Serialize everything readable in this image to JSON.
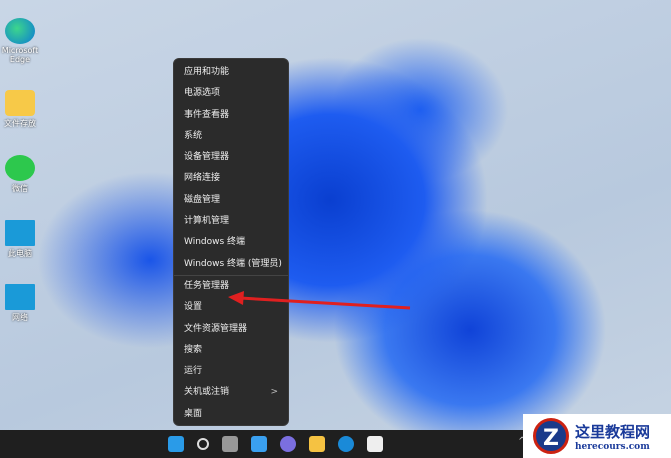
{
  "desktop_icons": [
    {
      "label": "Microsoft Edge",
      "icon": "edge-icon"
    },
    {
      "label": "文件存放",
      "icon": "folder-icon"
    },
    {
      "label": "微信",
      "icon": "wechat-icon"
    },
    {
      "label": "此电脑",
      "icon": "computer-icon"
    },
    {
      "label": "网络",
      "icon": "network-icon"
    }
  ],
  "menu": {
    "items": [
      "应用和功能",
      "电源选项",
      "事件查看器",
      "系统",
      "设备管理器",
      "网络连接",
      "磁盘管理",
      "计算机管理",
      "Windows 终端",
      "Windows 终端 (管理员)",
      "任务管理器",
      "设置",
      "文件资源管理器",
      "搜索",
      "运行",
      "关机或注销",
      "桌面"
    ],
    "chevron": ">"
  },
  "taskbar": {
    "items": [
      "start-icon",
      "search-icon",
      "task-view-icon",
      "widgets-icon",
      "chat-icon",
      "file-explorer-icon",
      "edge-icon",
      "store-icon"
    ],
    "tray_chevron": "^"
  },
  "watermark": {
    "title": "这里教程网",
    "url": "herecours.com"
  },
  "colors": {
    "arrow": "#e02020",
    "menu_bg": "#2b2b2b"
  }
}
